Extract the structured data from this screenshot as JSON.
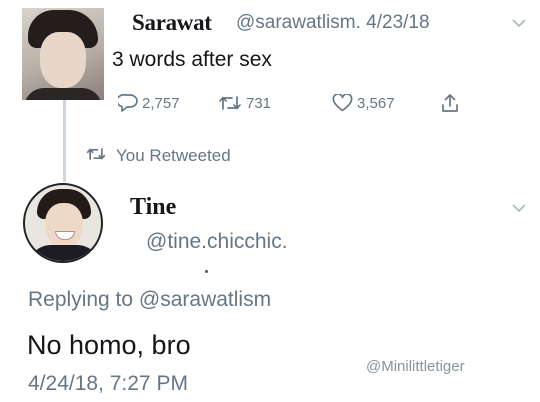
{
  "tweet1": {
    "name": "Sarawat",
    "handle": "@sarawatlism.",
    "date": "4/23/18",
    "text": "3 words after sex",
    "replies": "2,757",
    "retweets": "731",
    "likes": "3,567",
    "avatar_icon": "profile-photo"
  },
  "retweet_notice": {
    "label": "You Retweeted",
    "icon": "retweet-icon"
  },
  "tweet2": {
    "name": "Tine",
    "handle": "@tine.chicchic.",
    "replying_prefix": "Replying to",
    "replying_handle": "@sarawatlism",
    "text": "No homo, bro",
    "timestamp": "4/24/18, 7:27 PM",
    "avatar_icon": "profile-photo"
  },
  "watermark": "@Minilittletiger",
  "colors": {
    "text": "#14171a",
    "muted": "#657786",
    "thread_line": "#ccd6dd"
  }
}
